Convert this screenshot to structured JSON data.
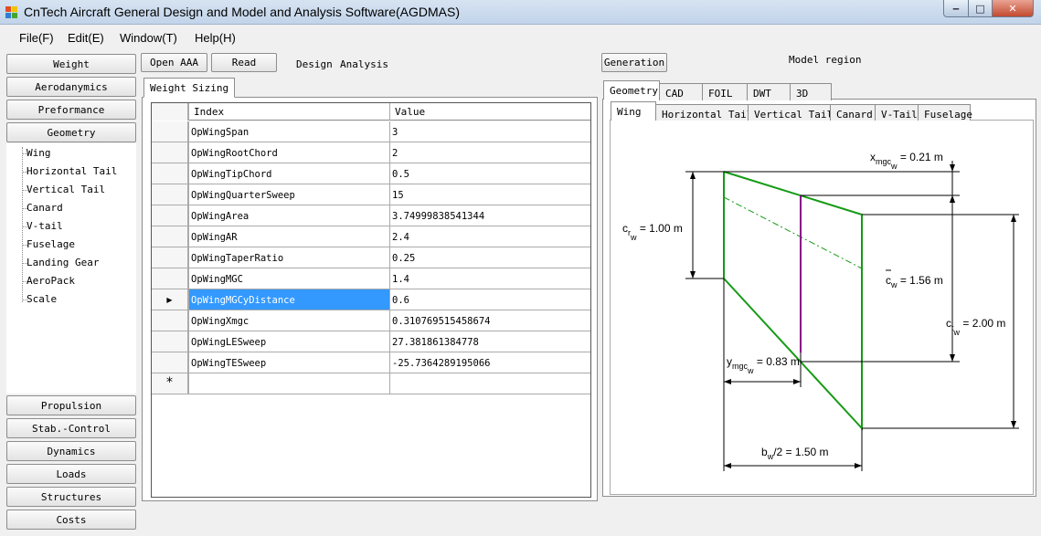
{
  "window": {
    "title": "CnTech Aircraft General Design and Model and Analysis Software(AGDMAS)",
    "controls": {
      "minimize": "‒",
      "maximize": "□",
      "close": "✕"
    },
    "icon": "app-icon"
  },
  "menu": [
    "File(F)",
    "Edit(E)",
    "Window(T)",
    "Help(H)"
  ],
  "nav": {
    "top_buttons": [
      "Weight",
      "Aerodanymics",
      "Preformance",
      "Geometry"
    ],
    "tree_items": [
      "Wing",
      "Horizontal Tail",
      "Vertical Tail",
      "Canard",
      "V-tail",
      "Fuselage",
      "Landing Gear",
      "AeroPack",
      "Scale"
    ],
    "bottom_buttons": [
      "Propulsion",
      "Stab.-Control",
      "Dynamics",
      "Loads",
      "Structures",
      "Costs"
    ]
  },
  "toolbar": {
    "open_aaa": "Open AAA",
    "read": "Read",
    "design": "Design",
    "analysis": "Analysis",
    "generation": "Generation",
    "model_region": "Model region"
  },
  "middle": {
    "tab": "Weight Sizing",
    "grid": {
      "columns": [
        "Index",
        "Value"
      ],
      "rows": [
        {
          "index": "OpWingSpan",
          "value": "3"
        },
        {
          "index": "OpWingRootChord",
          "value": "2"
        },
        {
          "index": "OpWingTipChord",
          "value": "0.5"
        },
        {
          "index": "OpWingQuarterSweep",
          "value": "15"
        },
        {
          "index": "OpWingArea",
          "value": "3.74999838541344"
        },
        {
          "index": "OpWingAR",
          "value": "2.4"
        },
        {
          "index": "OpWingTaperRatio",
          "value": "0.25"
        },
        {
          "index": "OpWingMGC",
          "value": "1.4"
        },
        {
          "index": "OpWingMGCyDistance",
          "value": "0.6"
        },
        {
          "index": "OpWingXmgc",
          "value": "0.310769515458674"
        },
        {
          "index": "OpWingLESweep",
          "value": "27.381861384778"
        },
        {
          "index": "OpWingTESweep",
          "value": "-25.7364289195066"
        }
      ],
      "selected_row": 8,
      "current_row_marker": "▶",
      "new_row_marker": "*"
    }
  },
  "right": {
    "outer_tabs": [
      "Geometry",
      "CAD",
      "FOIL",
      "DWT",
      "3D"
    ],
    "inner_tabs": [
      "Wing",
      "Horizontal Tail",
      "Vertical Tail",
      "Canard",
      "V-Tail",
      "Fuselage"
    ],
    "diagram_labels": {
      "x_mgc": {
        "main": "x",
        "sub1": "mgc",
        "sub2": "w",
        "value": " = 0.21 m"
      },
      "c_r": {
        "main": "c",
        "sub1": "r",
        "sub2": "w",
        "value": " = 1.00 m"
      },
      "c_bar": {
        "main": "c",
        "sub2": "w",
        "value": " = 1.56 m"
      },
      "c_t": {
        "main": "c",
        "sub1": "t",
        "sub2": "w",
        "value": " = 2.00 m"
      },
      "y_mgc": {
        "main": "y",
        "sub1": "mgc",
        "sub2": "w",
        "value": " = 0.83 m"
      },
      "b": {
        "main": "b",
        "sub2": "w",
        "value": "/2 = 1.50 m"
      }
    },
    "colors": {
      "outline": "#159a15",
      "mgc_line": "#8b008b",
      "selection": "#3399ff"
    }
  }
}
